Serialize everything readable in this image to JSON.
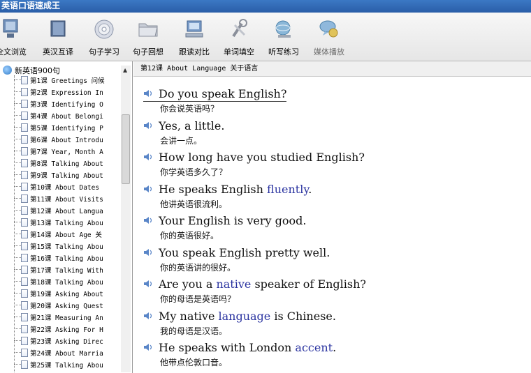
{
  "window": {
    "title": "英语口语速成王"
  },
  "toolbar": {
    "items": [
      {
        "label": "全文浏览"
      },
      {
        "label": "英汉互译"
      },
      {
        "label": "句子学习"
      },
      {
        "label": "句子回想"
      },
      {
        "label": "跟读对比"
      },
      {
        "label": "单词填空"
      },
      {
        "label": "听写练习"
      },
      {
        "label": "媒体播放"
      }
    ]
  },
  "tree": {
    "root_label": "新英语900句",
    "lessons": [
      {
        "label": "第1课 Greetings 问候"
      },
      {
        "label": "第2课 Expression In"
      },
      {
        "label": "第3课 Identifying O"
      },
      {
        "label": "第4课 About Belongi"
      },
      {
        "label": "第5课 Identifying P"
      },
      {
        "label": "第6课 About Introdu"
      },
      {
        "label": "第7课 Year, Month A"
      },
      {
        "label": "第8课 Talking About"
      },
      {
        "label": "第9课 Talking About"
      },
      {
        "label": "第10课 About Dates"
      },
      {
        "label": "第11课 About Visits"
      },
      {
        "label": "第12课 About Langua"
      },
      {
        "label": "第13课 Talking Abou"
      },
      {
        "label": "第14课 About Age 关"
      },
      {
        "label": "第15课 Talking Abou"
      },
      {
        "label": "第16课 Talking Abou"
      },
      {
        "label": "第17课 Talking With"
      },
      {
        "label": "第18课 Talking Abou"
      },
      {
        "label": "第19课 Asking About"
      },
      {
        "label": "第20课 Asking Quest"
      },
      {
        "label": "第21课 Measuring An"
      },
      {
        "label": "第22课 Asking For H"
      },
      {
        "label": "第23课 Asking Direc"
      },
      {
        "label": "第24课 About Marria"
      },
      {
        "label": "第25课 Talking Abou"
      }
    ]
  },
  "content": {
    "header": "第12课 About Language 关于语言",
    "sentences": [
      {
        "pre": "Do you speak English?",
        "hl": "",
        "post": "",
        "zh": "你会说英语吗？"
      },
      {
        "pre": "Yes, a little.",
        "hl": "",
        "post": "",
        "zh": "会讲一点。"
      },
      {
        "pre": "How long have you studied English?",
        "hl": "",
        "post": "",
        "zh": "你学英语多久了？"
      },
      {
        "pre": "He speaks English ",
        "hl": "fluently",
        "post": ".",
        "zh": "他讲英语很流利。"
      },
      {
        "pre": "Your English is very good.",
        "hl": "",
        "post": "",
        "zh": "你的英语很好。"
      },
      {
        "pre": "You speak English pretty well.",
        "hl": "",
        "post": "",
        "zh": "你的英语讲的很好。"
      },
      {
        "pre": "Are you a ",
        "hl": "native",
        "post": " speaker of English?",
        "zh": "你的母语是英语吗？"
      },
      {
        "pre": "My native ",
        "hl": "language",
        "post": " is Chinese.",
        "zh": "我的母语是汉语。"
      },
      {
        "pre": "He speaks with London ",
        "hl": "accent",
        "post": ".",
        "zh": "他带点伦敦口音。"
      }
    ]
  },
  "colors": {
    "titlebar": "#2a5ea8",
    "highlight": "#2a33a0",
    "speaker": "#5a86c8"
  }
}
